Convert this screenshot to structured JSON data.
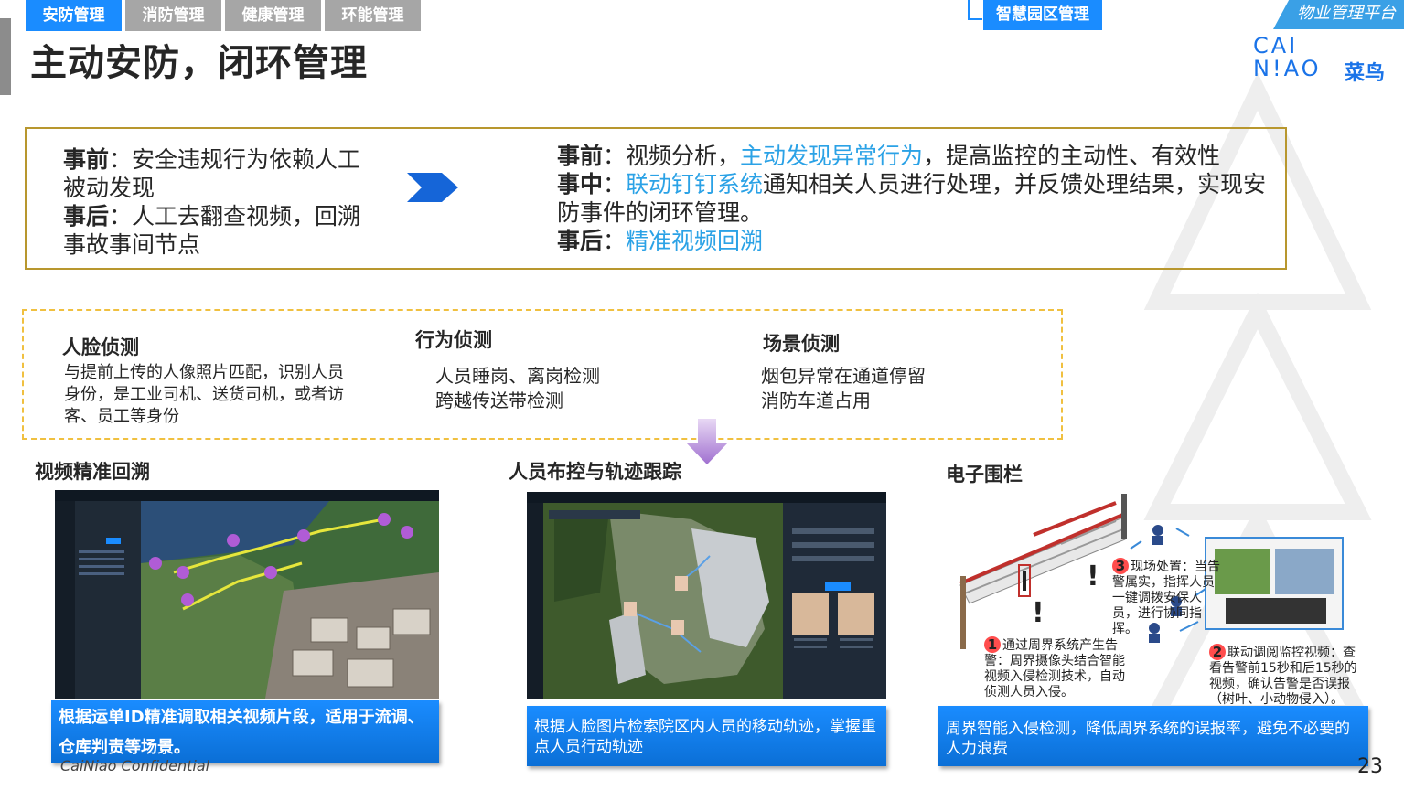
{
  "tabs": [
    "安防管理",
    "消防管理",
    "健康管理",
    "环能管理"
  ],
  "title": "主动安防，闭环管理",
  "zone_tag": "智慧园区管理",
  "platform": "物业管理平台",
  "logo": {
    "line1": "CAI",
    "line2": "N!AO",
    "cn": "菜鸟"
  },
  "colors": {
    "accent_blue": "#1a8cff",
    "highlight": "#2ba2e6",
    "gold_border": "#b8972e",
    "dash_border": "#f0c040",
    "grey_tab": "#a6a6a6"
  },
  "box1": {
    "left": {
      "before_label": "事前",
      "before_text": "：安全违规行为依赖人工被动发现",
      "after_label": "事后",
      "after_text": "：人工去翻查视频，回溯事故事间节点"
    },
    "right": {
      "before_label": "事前",
      "before_text_a": "：视频分析，",
      "before_hl": "主动发现异常行为",
      "before_text_b": "，提高监控的主动性、有效性",
      "during_label": "事中",
      "during_sep": "：",
      "during_hl": "联动钉钉系统",
      "during_text": "通知相关人员进行处理，并反馈处理结果，实现安防事件的闭环管理。",
      "after_label": "事后",
      "after_sep": "：",
      "after_hl": "精准视频回溯"
    }
  },
  "detect": {
    "face": {
      "title": "人脸侦测",
      "body": "与提前上传的人像照片匹配，识别人员身份，是工业司机、送货司机，或者访客、员工等身份"
    },
    "behavior": {
      "title": "行为侦测",
      "line1": "人员睡岗、离岗检测",
      "line2": "跨越传送带检测"
    },
    "scene": {
      "title": "场景侦测",
      "line1": "烟包异常在通道停留",
      "line2": "消防车道占用"
    }
  },
  "captions": {
    "video": "视频精准回溯",
    "track": "人员布控与轨迹跟踪",
    "fence": "电子围栏"
  },
  "banners": {
    "video_line1": "根据运单ID精准调取相关视频片段，适用于流调、",
    "video_line2": "仓库判责等场景。",
    "track": "根据人脸图片检索院区内人员的移动轨迹，掌握重点人员行动轨迹",
    "fence": "周界智能入侵检测，降低周界系统的误报率，避免不必要的人力浪费"
  },
  "fence_steps": {
    "s1_num": "1",
    "s1_text": "通过周界系统产生告警：周界摄像头结合智能视频入侵检测技术，自动侦测人员入侵。",
    "s2_num": "2",
    "s2_text": "联动调阅监控视频：查看告警前15秒和后15秒的视频，确认告警是否误报（树叶、小动物侵入）。",
    "s3_num": "3",
    "s3_text": "现场处置：当告警属实，指挥人员一键调拨安保人员，进行协同指挥。"
  },
  "confidential": "CaiNiao Confidential",
  "page_number": "23"
}
